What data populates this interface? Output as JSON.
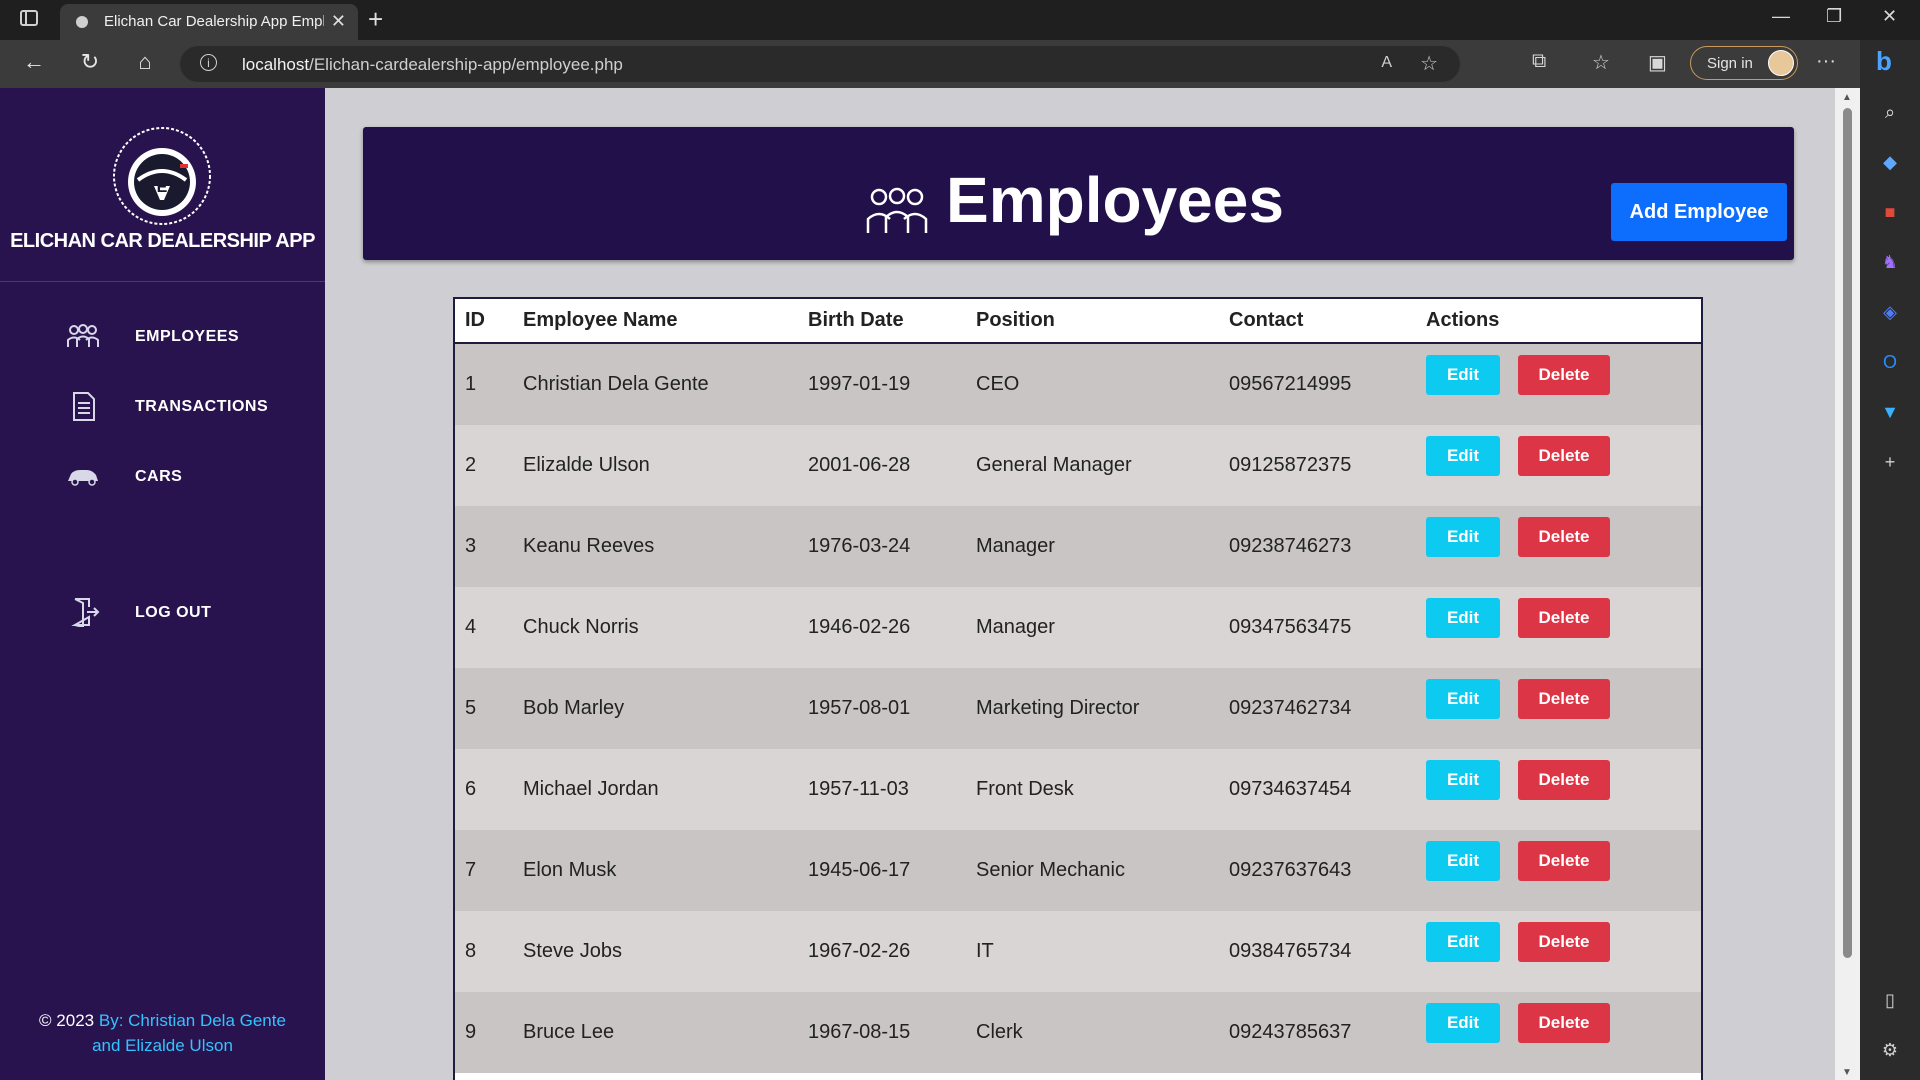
{
  "browser": {
    "tab_title": "Elichan Car Dealership App Empl",
    "url_host": "localhost",
    "url_path": "/Elichan-cardealership-app/employee.php",
    "sign_in": "Sign in"
  },
  "sidebar": {
    "brand": "ELICHAN CAR DEALERSHIP APP",
    "items": [
      {
        "label": "EMPLOYEES",
        "icon": "group-icon"
      },
      {
        "label": "TRANSACTIONS",
        "icon": "document-icon"
      },
      {
        "label": "CARS",
        "icon": "car-icon"
      },
      {
        "label": "LOG OUT",
        "icon": "logout-icon"
      }
    ],
    "footer_copy": "© 2023",
    "footer_by": "By: Christian Dela Gente",
    "footer_and": "and Elizalde Ulson"
  },
  "header": {
    "title": "Employees",
    "add_button": "Add Employee"
  },
  "table": {
    "columns": [
      "ID",
      "Employee Name",
      "Birth Date",
      "Position",
      "Contact",
      "Actions"
    ],
    "edit_label": "Edit",
    "delete_label": "Delete",
    "rows": [
      {
        "id": "1",
        "name": "Christian Dela Gente",
        "birth": "1997-01-19",
        "position": "CEO",
        "contact": "09567214995"
      },
      {
        "id": "2",
        "name": "Elizalde Ulson",
        "birth": "2001-06-28",
        "position": "General Manager",
        "contact": "09125872375"
      },
      {
        "id": "3",
        "name": "Keanu Reeves",
        "birth": "1976-03-24",
        "position": "Manager",
        "contact": "09238746273"
      },
      {
        "id": "4",
        "name": "Chuck Norris",
        "birth": "1946-02-26",
        "position": "Manager",
        "contact": "09347563475"
      },
      {
        "id": "5",
        "name": "Bob Marley",
        "birth": "1957-08-01",
        "position": "Marketing Director",
        "contact": "09237462734"
      },
      {
        "id": "6",
        "name": "Michael Jordan",
        "birth": "1957-11-03",
        "position": "Front Desk",
        "contact": "09734637454"
      },
      {
        "id": "7",
        "name": "Elon Musk",
        "birth": "1945-06-17",
        "position": "Senior Mechanic",
        "contact": "09237637643"
      },
      {
        "id": "8",
        "name": "Steve Jobs",
        "birth": "1967-02-26",
        "position": "IT",
        "contact": "09384765734"
      },
      {
        "id": "9",
        "name": "Bruce Lee",
        "birth": "1967-08-15",
        "position": "Clerk",
        "contact": "09243785637"
      }
    ]
  },
  "colors": {
    "sidebar_bg": "#29134f",
    "header_bg": "#21104a",
    "add_button": "#0d6efd",
    "edit_button": "#0dcaf0",
    "delete_button": "#dc3545"
  }
}
